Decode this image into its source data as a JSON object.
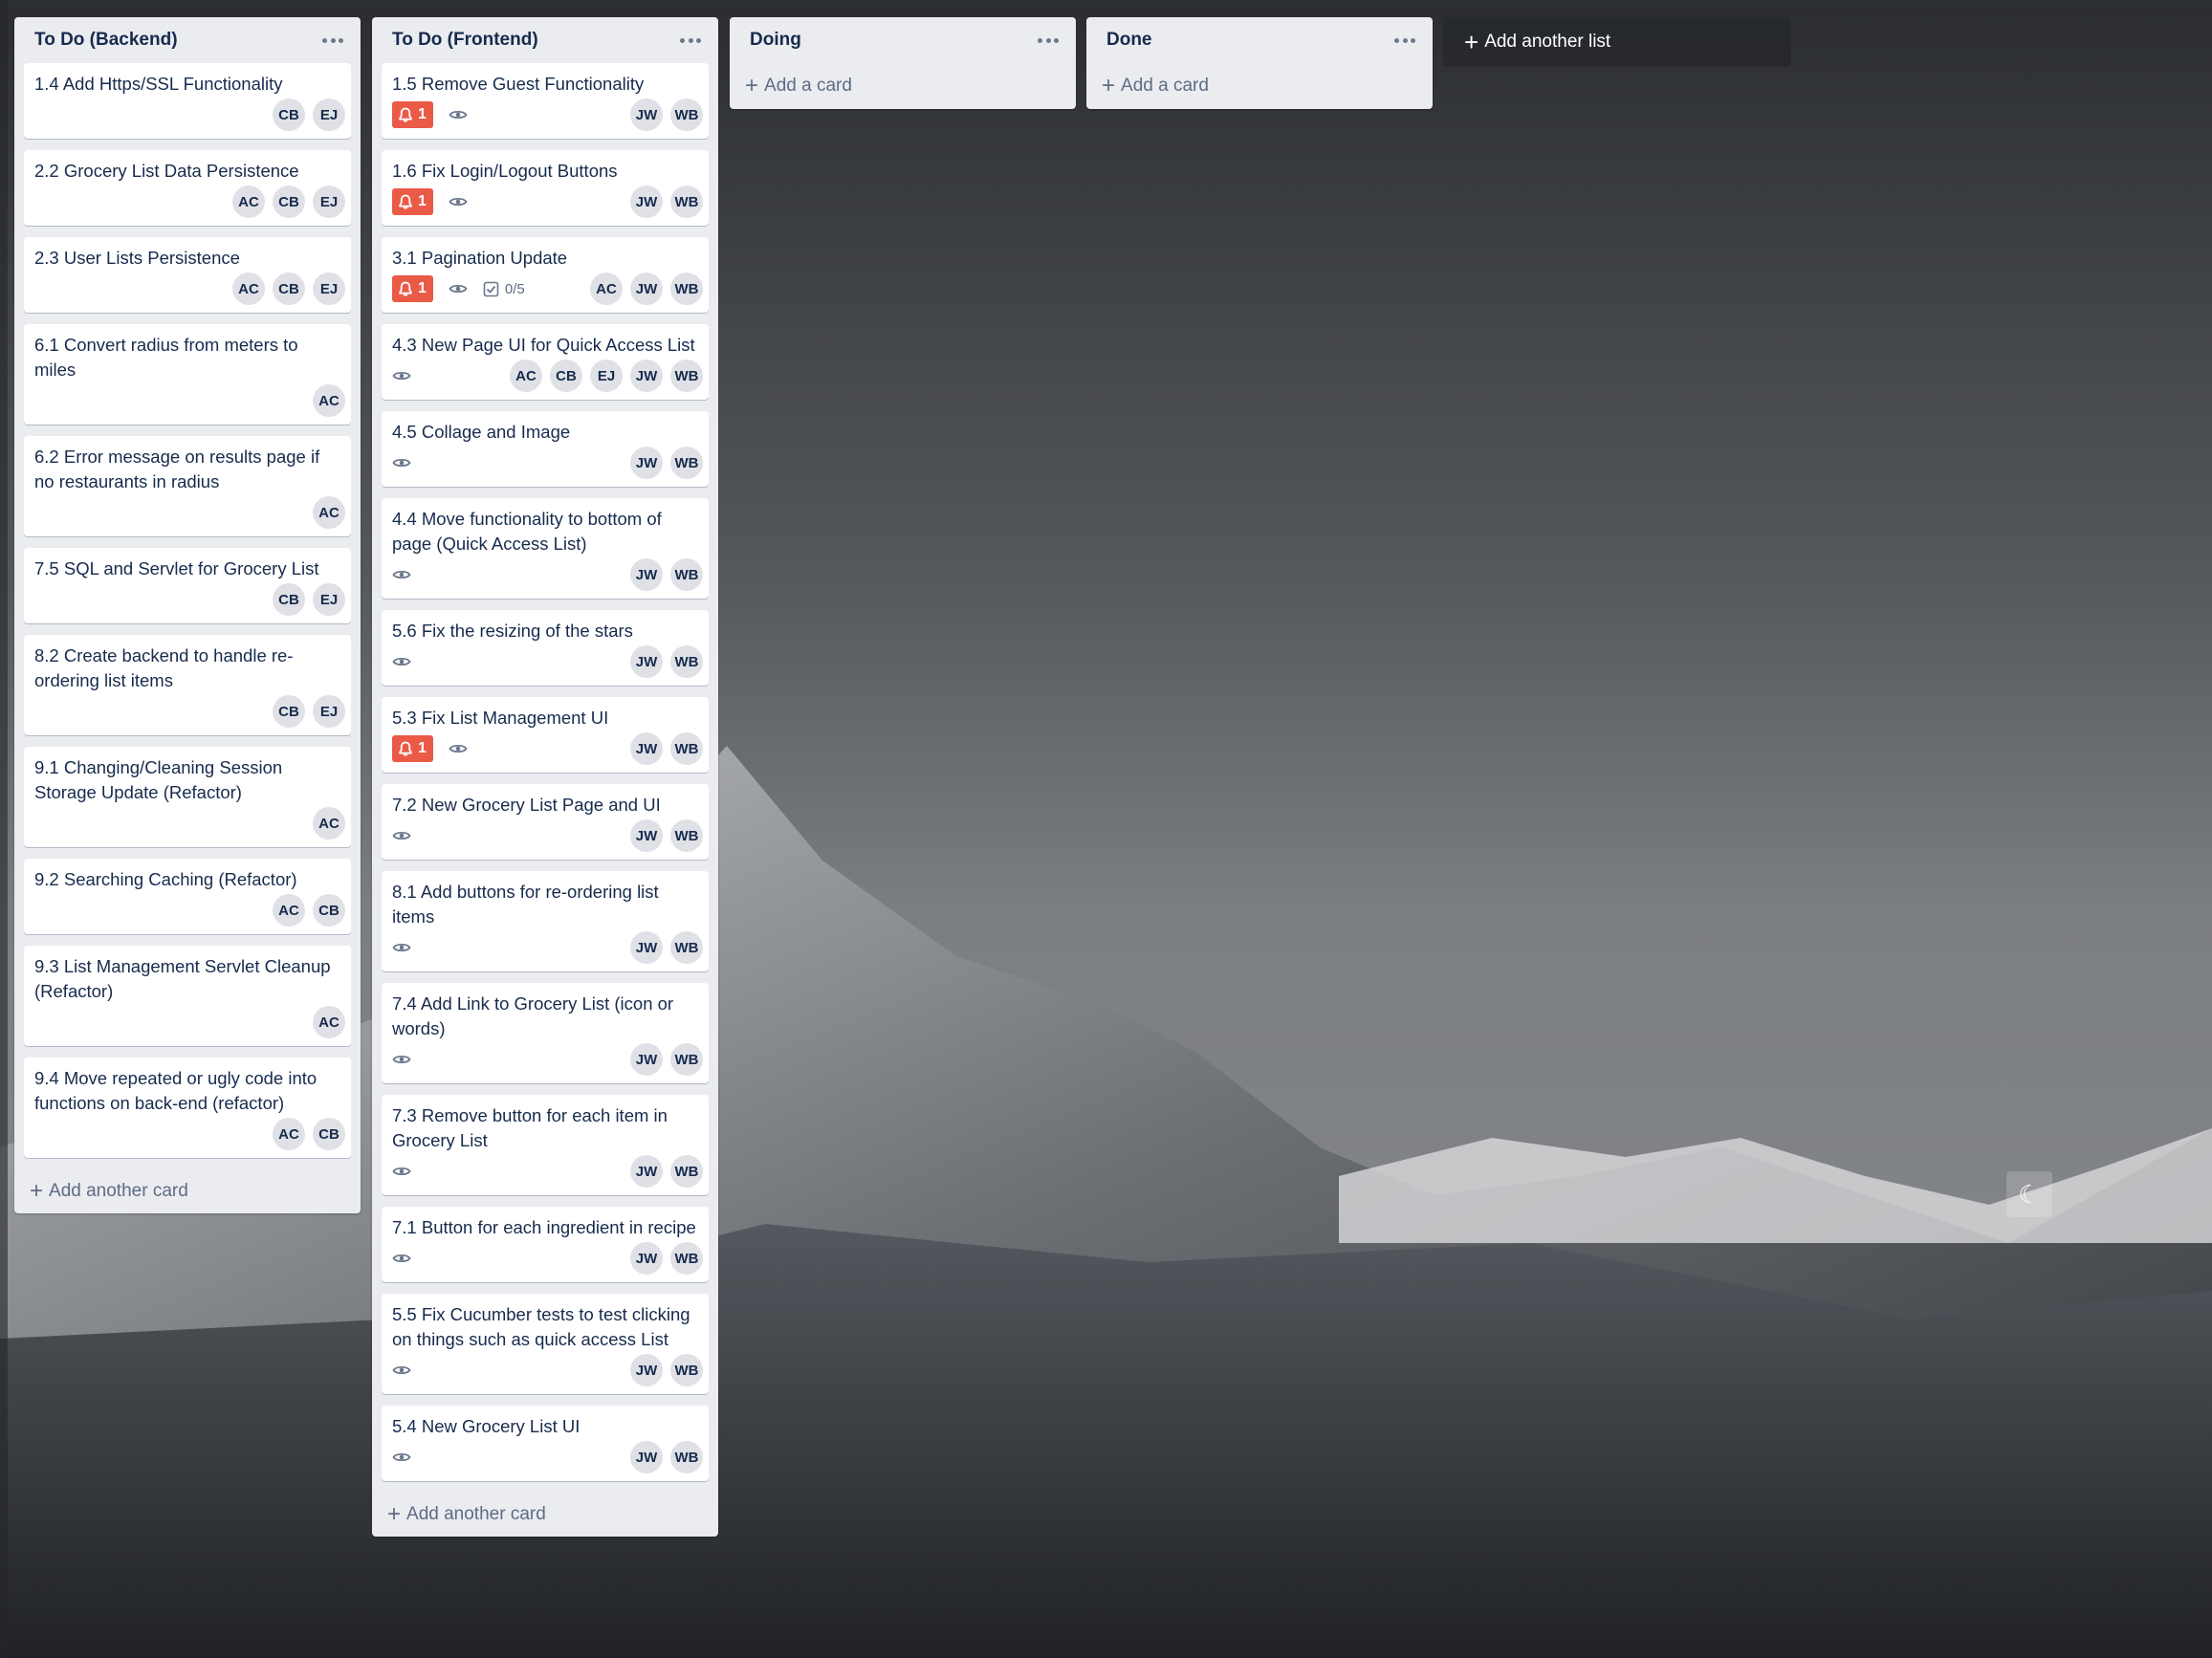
{
  "lists": [
    {
      "title": "To Do (Backend)",
      "cards": [
        {
          "title": "1.4 Add Https/SSL Functionality",
          "alert": "",
          "watch": false,
          "checklist": "",
          "members": [
            "CB",
            "EJ"
          ]
        },
        {
          "title": "2.2 Grocery List Data Persistence",
          "alert": "",
          "watch": false,
          "checklist": "",
          "members": [
            "AC",
            "CB",
            "EJ"
          ]
        },
        {
          "title": "2.3 User Lists Persistence",
          "alert": "",
          "watch": false,
          "checklist": "",
          "members": [
            "AC",
            "CB",
            "EJ"
          ]
        },
        {
          "title": "6.1 Convert radius from meters to miles",
          "alert": "",
          "watch": false,
          "checklist": "",
          "members": [
            "AC"
          ]
        },
        {
          "title": "6.2 Error message on results page if no restaurants in radius",
          "alert": "",
          "watch": false,
          "checklist": "",
          "members": [
            "AC"
          ]
        },
        {
          "title": "7.5 SQL and Servlet for Grocery List",
          "alert": "",
          "watch": false,
          "checklist": "",
          "members": [
            "CB",
            "EJ"
          ]
        },
        {
          "title": "8.2 Create backend to handle re-ordering list items",
          "alert": "",
          "watch": false,
          "checklist": "",
          "members": [
            "CB",
            "EJ"
          ]
        },
        {
          "title": "9.1 Changing/Cleaning Session Storage Update (Refactor)",
          "alert": "",
          "watch": false,
          "checklist": "",
          "members": [
            "AC"
          ]
        },
        {
          "title": "9.2 Searching Caching (Refactor)",
          "alert": "",
          "watch": false,
          "checklist": "",
          "members": [
            "AC",
            "CB"
          ]
        },
        {
          "title": "9.3 List Management Servlet Cleanup (Refactor)",
          "alert": "",
          "watch": false,
          "checklist": "",
          "members": [
            "AC"
          ]
        },
        {
          "title": "9.4 Move repeated or ugly code into functions on back-end (refactor)",
          "alert": "",
          "watch": false,
          "checklist": "",
          "members": [
            "AC",
            "CB"
          ]
        }
      ],
      "add_label": "Add another card"
    },
    {
      "title": "To Do (Frontend)",
      "cards": [
        {
          "title": "1.5 Remove Guest Functionality",
          "alert": "1",
          "watch": true,
          "checklist": "",
          "members": [
            "JW",
            "WB"
          ]
        },
        {
          "title": "1.6 Fix Login/Logout Buttons",
          "alert": "1",
          "watch": true,
          "checklist": "",
          "members": [
            "JW",
            "WB"
          ]
        },
        {
          "title": "3.1 Pagination Update",
          "alert": "1",
          "watch": true,
          "checklist": "0/5",
          "members": [
            "AC",
            "JW",
            "WB"
          ]
        },
        {
          "title": "4.3 New Page UI for Quick Access List",
          "alert": "",
          "watch": true,
          "checklist": "",
          "members": [
            "AC",
            "CB",
            "EJ",
            "JW",
            "WB"
          ]
        },
        {
          "title": "4.5 Collage and Image",
          "alert": "",
          "watch": true,
          "checklist": "",
          "members": [
            "JW",
            "WB"
          ]
        },
        {
          "title": "4.4 Move functionality to bottom of page (Quick Access List)",
          "alert": "",
          "watch": true,
          "checklist": "",
          "members": [
            "JW",
            "WB"
          ]
        },
        {
          "title": "5.6 Fix the resizing of the stars",
          "alert": "",
          "watch": true,
          "checklist": "",
          "members": [
            "JW",
            "WB"
          ]
        },
        {
          "title": "5.3 Fix List Management UI",
          "alert": "1",
          "watch": true,
          "checklist": "",
          "members": [
            "JW",
            "WB"
          ]
        },
        {
          "title": "7.2 New Grocery List Page and UI",
          "alert": "",
          "watch": true,
          "checklist": "",
          "members": [
            "JW",
            "WB"
          ]
        },
        {
          "title": "8.1 Add buttons for re-ordering list items",
          "alert": "",
          "watch": true,
          "checklist": "",
          "members": [
            "JW",
            "WB"
          ]
        },
        {
          "title": "7.4 Add Link to Grocery List (icon or words)",
          "alert": "",
          "watch": true,
          "checklist": "",
          "members": [
            "JW",
            "WB"
          ]
        },
        {
          "title": "7.3 Remove button for each item in Grocery List",
          "alert": "",
          "watch": true,
          "checklist": "",
          "members": [
            "JW",
            "WB"
          ]
        },
        {
          "title": "7.1 Button for each ingredient in recipe",
          "alert": "",
          "watch": true,
          "checklist": "",
          "members": [
            "JW",
            "WB"
          ]
        },
        {
          "title": "5.5 Fix Cucumber tests to test clicking on things such as quick access List",
          "alert": "",
          "watch": true,
          "checklist": "",
          "members": [
            "JW",
            "WB"
          ]
        },
        {
          "title": "5.4 New Grocery List UI",
          "alert": "",
          "watch": true,
          "checklist": "",
          "members": [
            "JW",
            "WB"
          ]
        }
      ],
      "add_label": "Add another card"
    },
    {
      "title": "Doing",
      "cards": [],
      "add_label": "Add a card"
    },
    {
      "title": "Done",
      "cards": [],
      "add_label": "Add a card"
    }
  ],
  "add_list_label": "Add another list",
  "colors": {
    "list_bg": "#ebecf0",
    "card_bg": "#ffffff",
    "alert_red": "#eb5a46",
    "text": "#172b4d",
    "muted": "#5e6c84"
  },
  "icons": [
    "bell-icon",
    "eye-icon",
    "checklist-icon",
    "ellipsis-icon",
    "plus-icon",
    "moon-icon"
  ]
}
